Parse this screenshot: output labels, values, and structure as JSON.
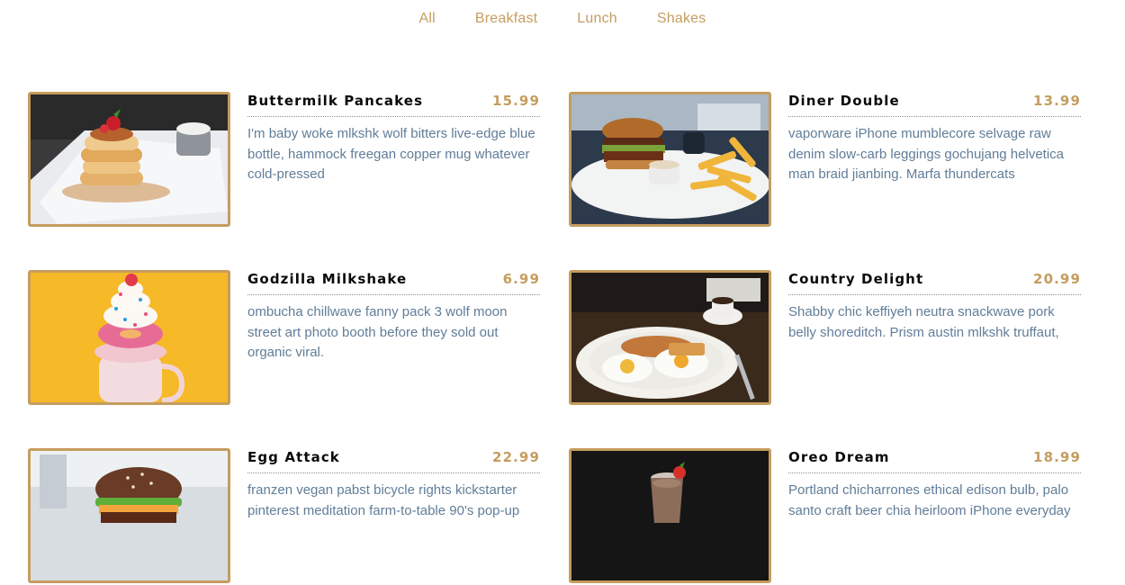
{
  "filters": {
    "all": "All",
    "breakfast": "Breakfast",
    "lunch": "Lunch",
    "shakes": "Shakes"
  },
  "accent_color": "#c59d5f",
  "text_color": "#617d98",
  "menu": [
    {
      "title": "Buttermilk Pancakes",
      "price": "15.99",
      "desc": "I'm baby woke mlkshk wolf bitters live-edge blue bottle, hammock freegan copper mug whatever cold-pressed",
      "image": "pancakes-photo"
    },
    {
      "title": "Diner Double",
      "price": "13.99",
      "desc": "vaporware iPhone mumblecore selvage raw denim slow-carb leggings gochujang helvetica man braid jianbing. Marfa thundercats",
      "image": "burger-fries-photo"
    },
    {
      "title": "Godzilla Milkshake",
      "price": "6.99",
      "desc": "ombucha chillwave fanny pack 3 wolf moon street art photo booth before they sold out organic viral.",
      "image": "milkshake-photo"
    },
    {
      "title": "Country Delight",
      "price": "20.99",
      "desc": "Shabby chic keffiyeh neutra snackwave pork belly shoreditch. Prism austin mlkshk truffaut,",
      "image": "eggs-breakfast-photo"
    },
    {
      "title": "Egg Attack",
      "price": "22.99",
      "desc": "franzen vegan pabst bicycle rights kickstarter pinterest meditation farm-to-table 90's pop-up",
      "image": "burger-photo"
    },
    {
      "title": "Oreo Dream",
      "price": "18.99",
      "desc": "Portland chicharrones ethical edison bulb, palo santo craft beer chia heirloom iPhone everyday",
      "image": "chocolate-shake-photo"
    }
  ]
}
